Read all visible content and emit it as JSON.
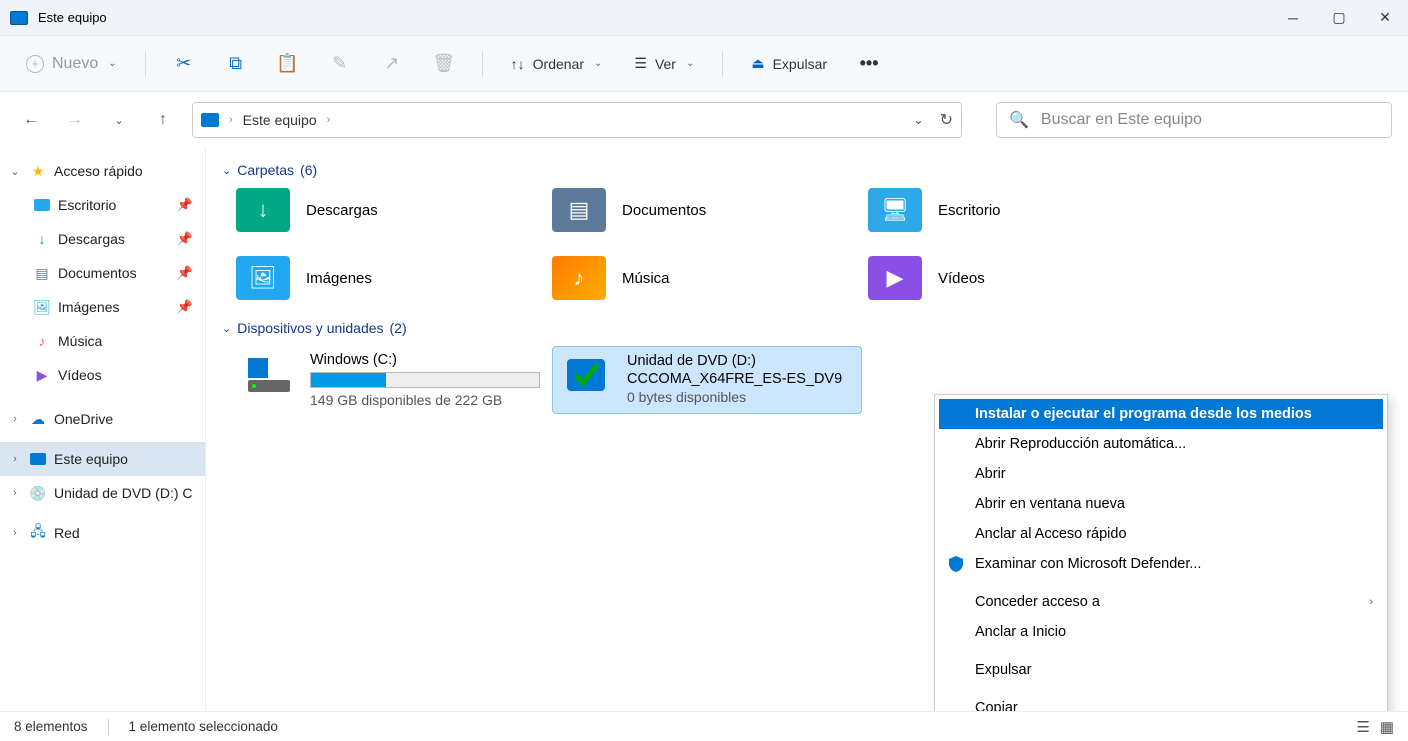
{
  "window": {
    "title": "Este equipo"
  },
  "toolbar": {
    "new": "Nuevo",
    "sort": "Ordenar",
    "view": "Ver",
    "eject": "Expulsar"
  },
  "breadcrumb": {
    "label": "Este equipo"
  },
  "search": {
    "placeholder": "Buscar en Este equipo"
  },
  "sidebar": {
    "quick": "Acceso rápido",
    "items": [
      {
        "label": "Escritorio"
      },
      {
        "label": "Descargas"
      },
      {
        "label": "Documentos"
      },
      {
        "label": "Imágenes"
      },
      {
        "label": "Música"
      },
      {
        "label": "Vídeos"
      }
    ],
    "onedrive": "OneDrive",
    "thispc": "Este equipo",
    "dvd": "Unidad de DVD (D:) C",
    "network": "Red"
  },
  "groups": {
    "folders": {
      "label": "Carpetas",
      "count": "(6)"
    },
    "drives": {
      "label": "Dispositivos y unidades",
      "count": "(2)"
    }
  },
  "folders": [
    {
      "label": "Descargas"
    },
    {
      "label": "Documentos"
    },
    {
      "label": "Escritorio"
    },
    {
      "label": "Imágenes"
    },
    {
      "label": "Música"
    },
    {
      "label": "Vídeos"
    }
  ],
  "drives": [
    {
      "name": "Windows (C:)",
      "status": "149 GB disponibles de 222 GB",
      "fill_pct": 33
    },
    {
      "name": "Unidad de DVD (D:)",
      "subname": "CCCOMA_X64FRE_ES-ES_DV9",
      "status": "0 bytes disponibles"
    }
  ],
  "context_menu": [
    {
      "label": "Instalar o ejecutar el programa desde los medios",
      "hover": true
    },
    {
      "label": "Abrir Reproducción automática..."
    },
    {
      "label": "Abrir"
    },
    {
      "label": "Abrir en ventana nueva"
    },
    {
      "label": "Anclar al Acceso rápido"
    },
    {
      "label": "Examinar con Microsoft Defender...",
      "icon": "shield"
    },
    {
      "label": "Conceder acceso a",
      "submenu": true,
      "sep_before": true
    },
    {
      "label": "Anclar a Inicio"
    },
    {
      "label": "Expulsar",
      "sep_before": true
    },
    {
      "label": "Copiar",
      "sep_before": true
    }
  ],
  "statusbar": {
    "count": "8 elementos",
    "selected": "1 elemento seleccionado"
  }
}
